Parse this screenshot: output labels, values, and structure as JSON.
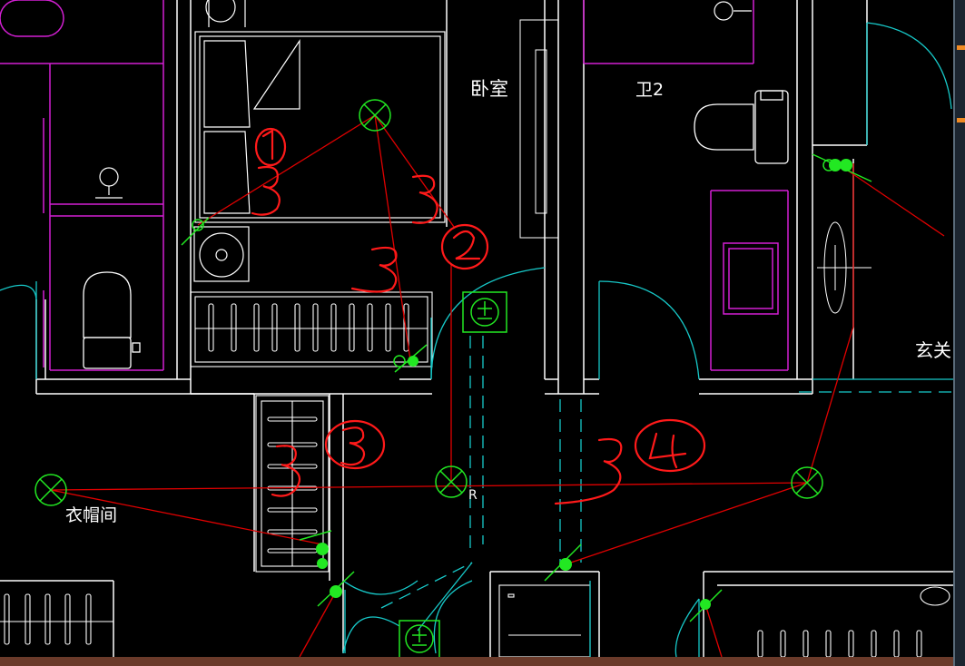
{
  "labels": {
    "bedroom": "卧室",
    "bathroom2": "卫2",
    "foyer": "玄关",
    "cloakroom": "衣帽间",
    "r_tag": "R"
  },
  "colors": {
    "background": "#000000",
    "wall": "#ffffff",
    "magenta": "#d21fd2",
    "cyan": "#17c9c9",
    "green": "#22e822",
    "wire": "#e00000",
    "annotation": "#ff1a1a"
  },
  "annotations": [
    "①",
    "3",
    "3",
    "3",
    "②",
    "3",
    "③",
    "3",
    "④"
  ]
}
